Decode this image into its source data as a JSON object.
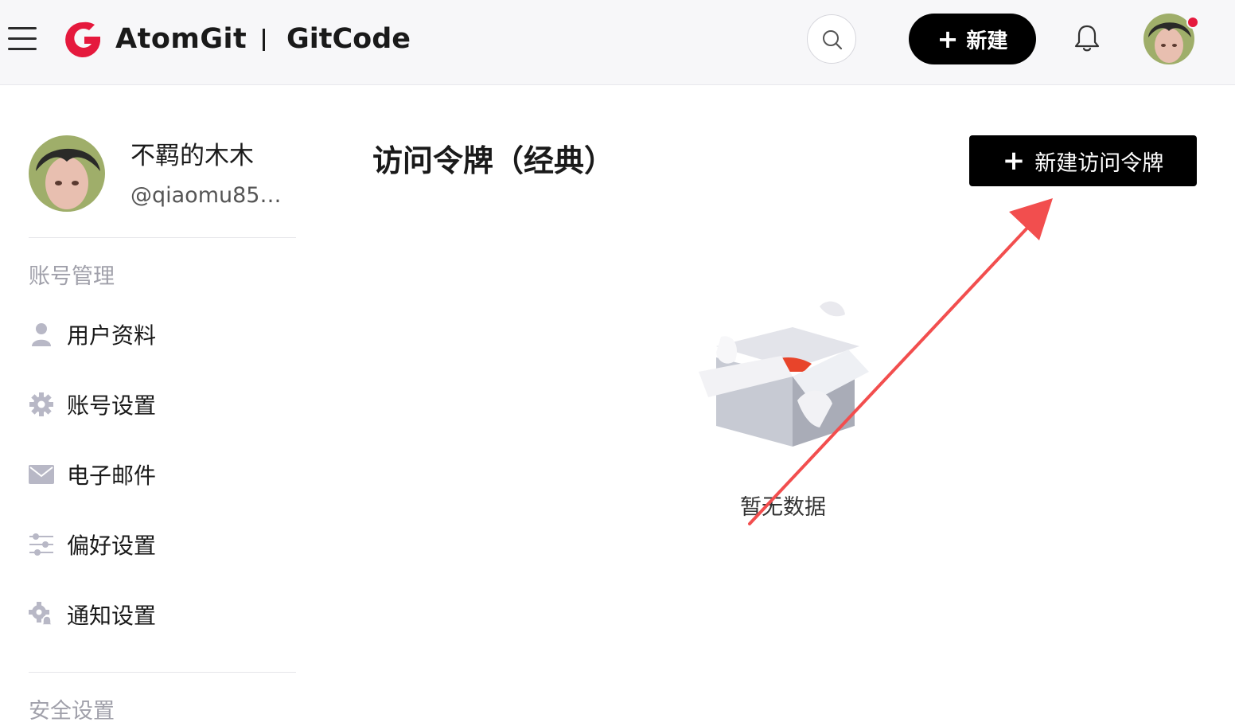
{
  "header": {
    "brand_primary": "AtomGit",
    "brand_secondary": "GitCode",
    "new_button_label": "新建",
    "icons": [
      "menu-icon",
      "search-icon",
      "plus-icon",
      "bell-icon"
    ]
  },
  "user": {
    "name": "不羁的木木",
    "handle": "@qiaomu855..."
  },
  "sidebar": {
    "section_account": "账号管理",
    "items": [
      {
        "label": "用户资料",
        "icon": "user-icon"
      },
      {
        "label": "账号设置",
        "icon": "gear-icon"
      },
      {
        "label": "电子邮件",
        "icon": "mail-icon"
      },
      {
        "label": "偏好设置",
        "icon": "sliders-icon"
      },
      {
        "label": "通知设置",
        "icon": "gear-bell-icon"
      }
    ],
    "section_security": "安全设置"
  },
  "main": {
    "title": "访问令牌（经典）",
    "create_button_label": "新建访问令牌",
    "empty_text": "暂无数据"
  },
  "colors": {
    "brand_red": "#e5193d",
    "primary_button": "#000000",
    "annotation_arrow": "#f24e4e"
  }
}
